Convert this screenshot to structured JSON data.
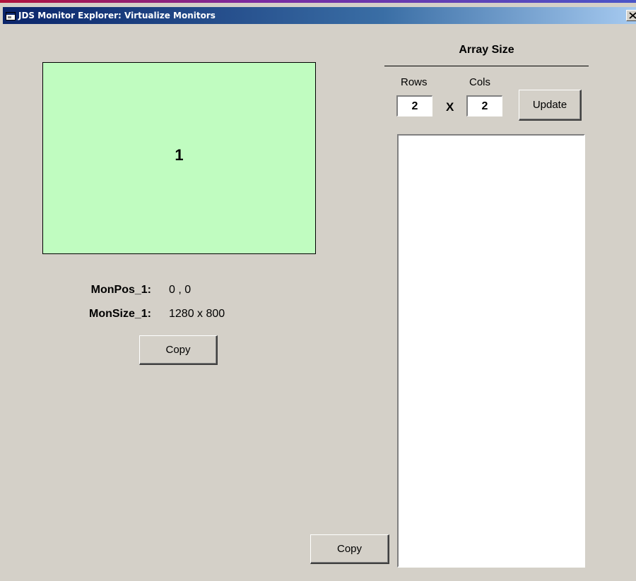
{
  "window": {
    "title": "JDS Monitor Explorer: Virtualize Monitors",
    "icon": "app-window-icon",
    "close_icon": "close-icon"
  },
  "monitor": {
    "number": "1",
    "fill_color": "#c0fcc0"
  },
  "info": {
    "pos_label": "MonPos_1:",
    "pos_value": "0 , 0",
    "size_label": "MonSize_1:",
    "size_value": "1280 x 800"
  },
  "buttons": {
    "copy_monitor": "Copy",
    "copy_array": "Copy",
    "update": "Update"
  },
  "array": {
    "title": "Array Size",
    "rows_label": "Rows",
    "cols_label": "Cols",
    "rows_value": "2",
    "cols_value": "2",
    "times_sign": "X"
  },
  "colors": {
    "dialog_background": "#d4d0c8",
    "titlebar_start": "#0a246a",
    "titlebar_end": "#a6caf0"
  }
}
